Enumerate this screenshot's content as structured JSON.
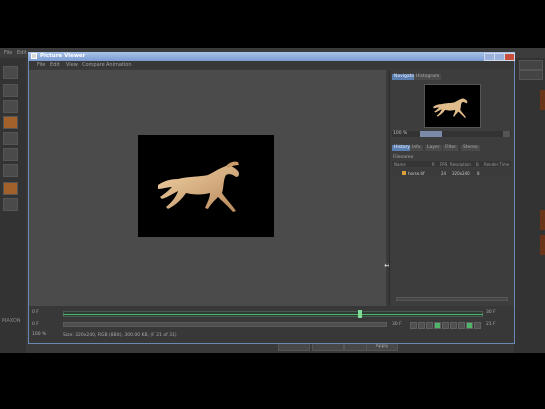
{
  "host": {
    "menu": [
      "File",
      "Edit"
    ],
    "logo_text": "MAXON",
    "bottom_buttons": [
      "",
      "",
      "",
      "Apply"
    ]
  },
  "window": {
    "title": "Picture Viewer",
    "menu": [
      "File",
      "Edit",
      "View",
      "Compare",
      "Animation"
    ]
  },
  "panel": {
    "tabs": [
      "Navigator",
      "Histogram"
    ],
    "zoom": "100 %",
    "subtabs": [
      "History",
      "Info",
      "Layer",
      "Filter",
      "Stereo"
    ],
    "history_label": "Filename",
    "columns": [
      "Name",
      "R",
      "FPS",
      "Resolution",
      "B",
      "Render Time"
    ],
    "rows": [
      {
        "name": "horse.tif",
        "fps": "24",
        "resolution": "320x240",
        "b": "8"
      }
    ]
  },
  "timeline": {
    "start_frame": "0 F",
    "end_frame": "30 F",
    "range_start": "0 F",
    "range_end": "30 F",
    "current_frame": "21 F",
    "zoom": "100 %",
    "status": "Size: 320x240, RGB (8Bit), 300.00 KB,  (F 21 of 31)"
  },
  "colors": {
    "title_bar": "#8aa8d9",
    "timeline_green": "#4fb56b",
    "active_tab": "#5c7fb2"
  }
}
